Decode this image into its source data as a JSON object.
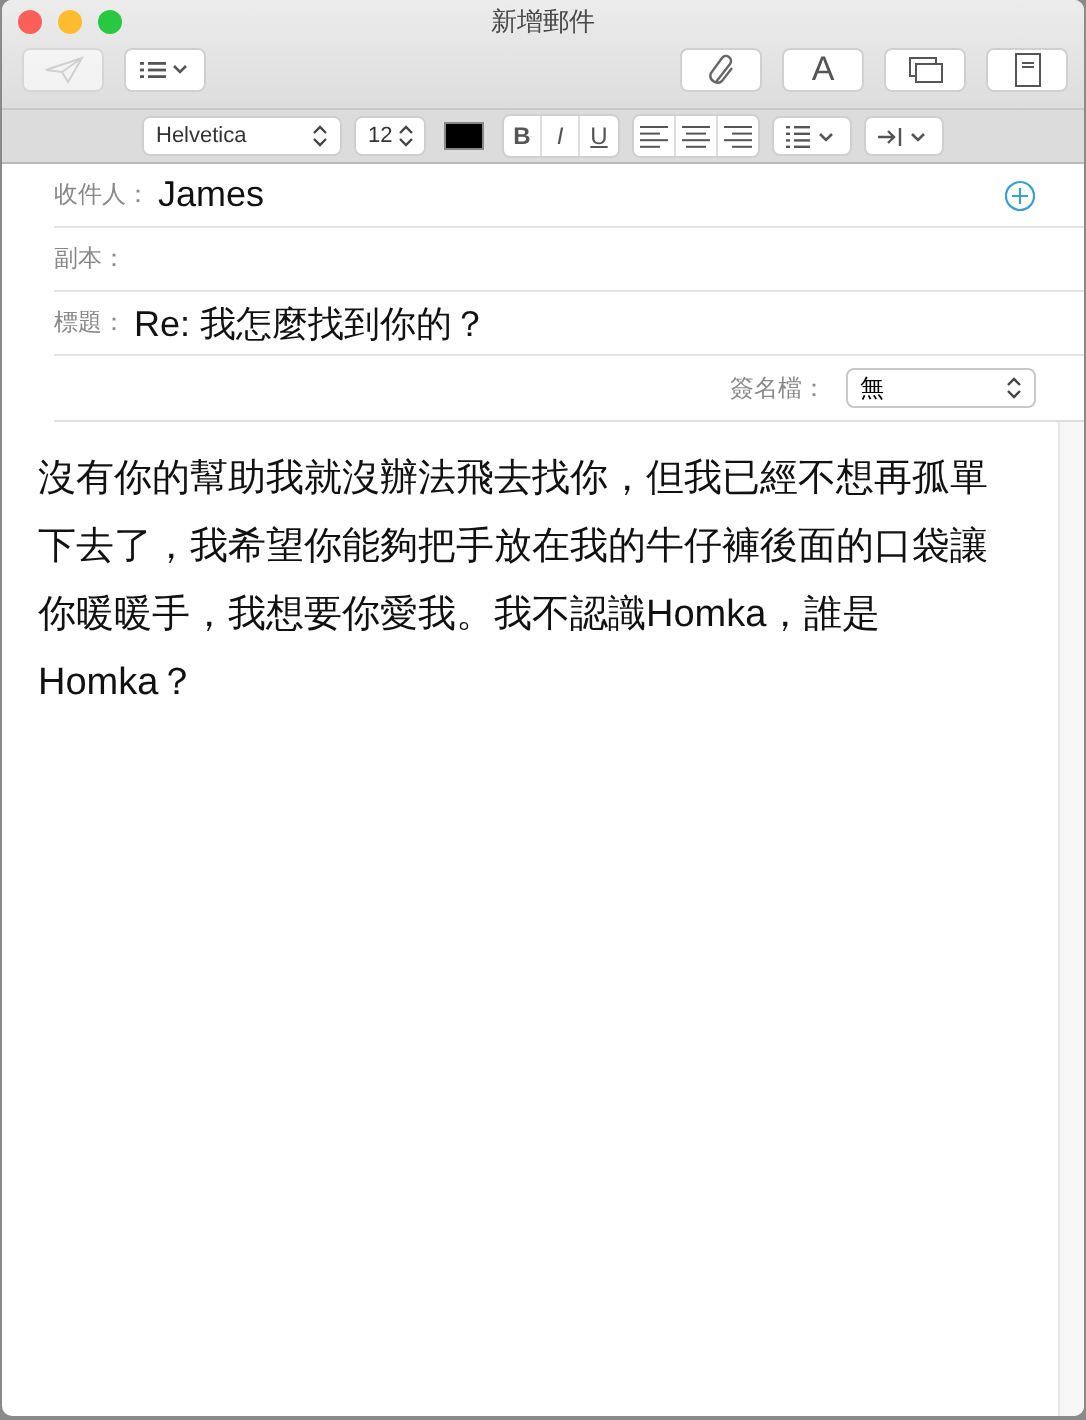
{
  "window": {
    "title": "新增郵件"
  },
  "toolbar": {
    "left": [
      {
        "kind": "send",
        "disabled": true
      },
      {
        "kind": "header-menu"
      }
    ],
    "right": [
      {
        "kind": "attach"
      },
      {
        "kind": "fonts",
        "label": "A"
      },
      {
        "kind": "photos"
      },
      {
        "kind": "stationery"
      }
    ]
  },
  "format_bar": {
    "font": "Helvetica",
    "size": "12",
    "styles": [
      "B",
      "I",
      "U"
    ]
  },
  "headers": [
    {
      "label": "收件人：",
      "value": "James",
      "add_button": true
    },
    {
      "label": "副本："
    },
    {
      "label": "標題：",
      "value": "Re: 我怎麼找到你的？"
    }
  ],
  "signature": {
    "label": "簽名檔：",
    "value": "無"
  },
  "body": "沒有你的幫助我就沒辦法飛去找你，但我已經不想再孤單下去了，我希望你能夠把手放在我的牛仔褲後面的口袋讓你暖暖手，我想要你愛我。我不認識Homka，誰是Homka？"
}
